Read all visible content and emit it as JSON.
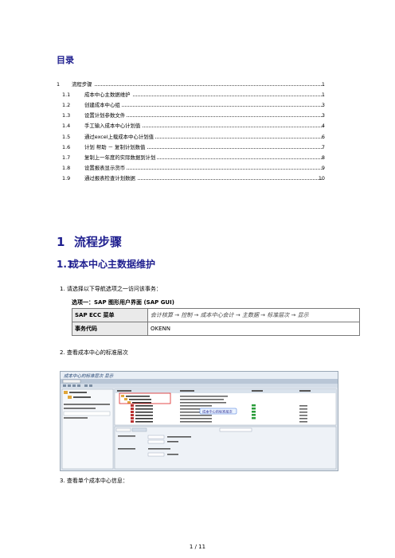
{
  "toc": {
    "title": "目录",
    "entries": [
      {
        "num": "1",
        "text": "流程步骤",
        "page": "1",
        "level": 1
      },
      {
        "num": "1.1",
        "text": "成本中心主数据维护",
        "page": "1",
        "level": 2
      },
      {
        "num": "1.2",
        "text": "创建成本中心组",
        "page": "3",
        "level": 2
      },
      {
        "num": "1.3",
        "text": "设置计划参数文件",
        "page": "3",
        "level": 2
      },
      {
        "num": "1.4",
        "text": "手工输入成本中心计划值",
        "page": "4",
        "level": 2
      },
      {
        "num": "1.5",
        "text": "通过excel上载成本中心计划值",
        "page": "6",
        "level": 2
      },
      {
        "num": "1.6",
        "text": "计划 帮助 － 复制计划数值",
        "page": "7",
        "level": 2
      },
      {
        "num": "1.7",
        "text": "复制上一年度的实际数据到计划",
        "page": "8",
        "level": 2
      },
      {
        "num": "1.8",
        "text": "设置报表显示货币",
        "page": "9",
        "level": 2
      },
      {
        "num": "1.9",
        "text": "通过报表检查计划数据",
        "page": "10",
        "level": 2
      }
    ]
  },
  "section1": {
    "num": "1",
    "title": "流程步骤"
  },
  "section11": {
    "num": "1.1",
    "title": "成本中心主数据维护"
  },
  "steps": {
    "s1": "1.   请选择以下导航选项之一访问该事务：",
    "option": "选项一：SAP 图形用户界面 (SAP GUI)",
    "s2": "2.   查看成本中心的标准层次",
    "s3": "3.   查看单个成本中心信息："
  },
  "nav_table": {
    "menu_label": "SAP ECC 菜单",
    "menu_value": "会计核算 → 控制 → 成本中心会计 → 主数据 → 标准层次 → 显示",
    "tcode_label": "事务代码",
    "tcode_value": "OKENN"
  },
  "screenshot": {
    "title": "成本中心的标准层次 显示",
    "callout": "成本中心的标准层次"
  },
  "footer": "1 / 11"
}
